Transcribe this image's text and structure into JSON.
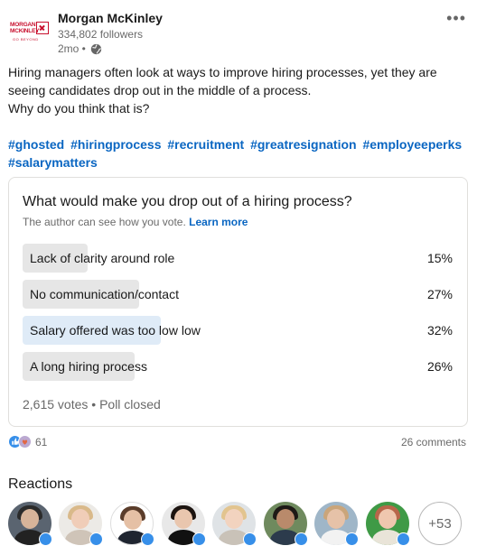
{
  "post": {
    "author": "Morgan McKinley",
    "logo_line1": "MORGAN",
    "logo_line2": "MCKINLEY",
    "logo_line3": "GO BEYOND",
    "followers": "334,802 followers",
    "time": "2mo •",
    "more_label": "•••",
    "body_line1": "Hiring managers often look at ways to improve hiring processes, yet they are",
    "body_line2": "seeing candidates drop out in the middle of a process.",
    "body_line3": "Why do you think that is?",
    "hashtags": [
      "#ghosted",
      "#hiringprocess",
      "#recruitment",
      "#greatresignation",
      "#employeeperks",
      "#salarymatters"
    ]
  },
  "poll": {
    "question": "What would make you drop out of a hiring process?",
    "note": "The author can see how you vote.",
    "learn_more": "Learn more",
    "options": [
      {
        "label": "Lack of clarity around role",
        "percent_label": "15%",
        "percent": 15
      },
      {
        "label": "No communication/contact",
        "percent_label": "27%",
        "percent": 27
      },
      {
        "label": "Salary offered was too low low",
        "percent_label": "32%",
        "percent": 32
      },
      {
        "label": "A long hiring process",
        "percent_label": "26%",
        "percent": 26
      }
    ],
    "winner_index": 2,
    "votes": "2,615 votes • Poll closed"
  },
  "social": {
    "reaction_count": "61",
    "comments": "26 comments",
    "reaction_icons": [
      "like-icon",
      "support-icon"
    ]
  },
  "reactions": {
    "title": "Reactions",
    "more": "+53",
    "avatar_count": 9
  },
  "colors": {
    "accent": "#0a66c2",
    "bar": "#e6e6e6",
    "bar_selected": "#dfebf7",
    "brand": "#c8102e",
    "like": "#378fe9"
  }
}
